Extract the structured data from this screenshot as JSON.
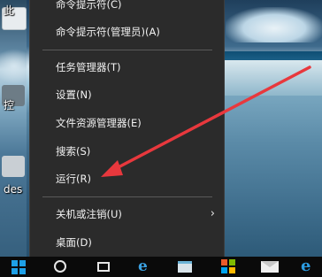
{
  "desktop": {
    "icon_labels": [
      "此",
      "控",
      "des"
    ]
  },
  "context_menu": {
    "items": [
      {
        "label": "命令提示符(C)"
      },
      {
        "label": "命令提示符(管理员)(A)"
      },
      {
        "label": "任务管理器(T)"
      },
      {
        "label": "设置(N)"
      },
      {
        "label": "文件资源管理器(E)"
      },
      {
        "label": "搜索(S)"
      },
      {
        "label": "运行(R)"
      },
      {
        "label": "关机或注销(U)",
        "submenu_glyph": "›"
      },
      {
        "label": "桌面(D)"
      }
    ]
  },
  "annotation": {
    "arrow_color": "#e8383d"
  },
  "taskbar": {
    "edge_glyph": "e",
    "ie_glyph": "e"
  }
}
